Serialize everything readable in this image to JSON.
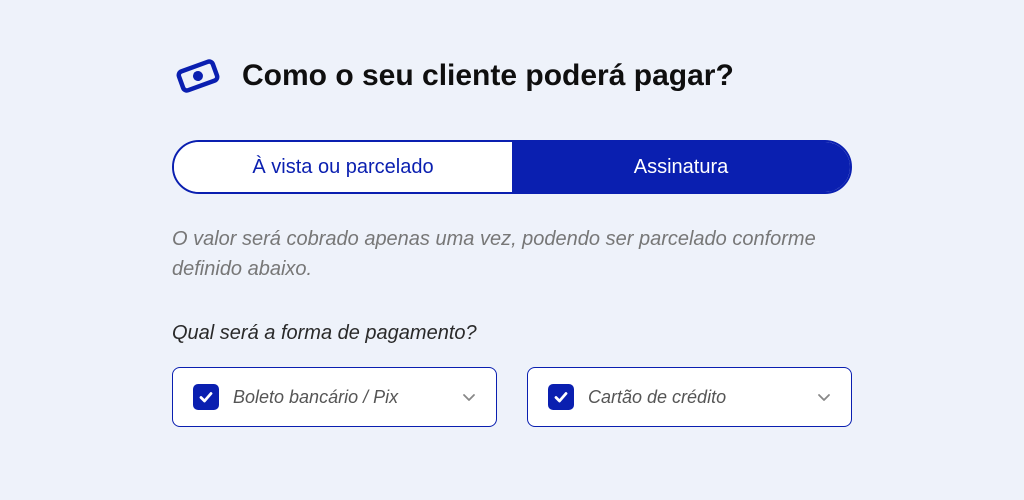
{
  "header": {
    "title": "Como o seu cliente poderá pagar?"
  },
  "segmented": {
    "option1": "À vista ou parcelado",
    "option2": "Assinatura"
  },
  "description": "O valor será cobrado apenas uma vez, podendo ser parcelado conforme definido abaixo.",
  "paymentForm": {
    "subtitle": "Qual será a forma de pagamento?",
    "methods": [
      {
        "label": "Boleto bancário / Pix",
        "checked": true
      },
      {
        "label": "Cartão de crédito",
        "checked": true
      }
    ]
  },
  "colors": {
    "primary": "#0a1fb0",
    "bg": "#eef2fa"
  }
}
